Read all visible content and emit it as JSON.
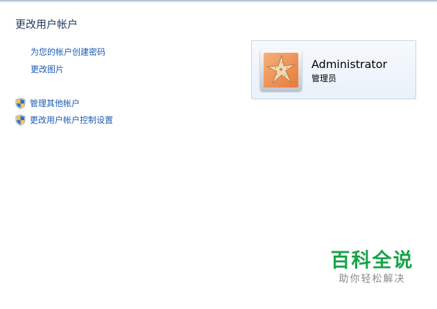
{
  "page": {
    "title": "更改用户帐户"
  },
  "tasks": {
    "create_password": "为您的帐户创建密码",
    "change_picture": "更改图片",
    "manage_other_accounts": "管理其他帐户",
    "uac_settings": "更改用户帐户控制设置"
  },
  "account": {
    "name": "Administrator",
    "role": "管理员",
    "avatar_icon": "starfish-picture"
  },
  "watermark": {
    "main": "百科全说",
    "sub": "助你轻松解决"
  },
  "colors": {
    "title": "#1e395b",
    "link": "#1e5cb3",
    "card_border": "#c5d5e6",
    "watermark_green": "#18a34a"
  }
}
